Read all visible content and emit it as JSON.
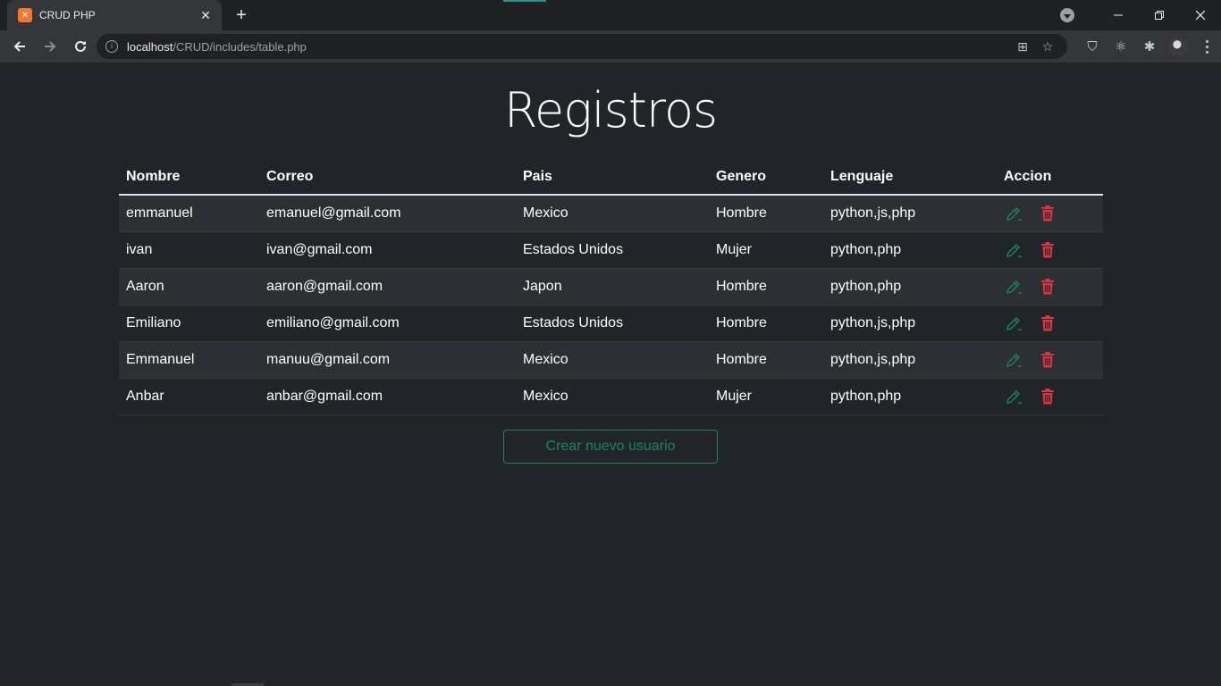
{
  "browser": {
    "tab_title": "CRUD PHP",
    "favicon_text": "⌘",
    "url_host": "localhost",
    "url_path": "/CRUD/includes/table.php"
  },
  "page": {
    "title": "Registros",
    "headers": [
      "Nombre",
      "Correo",
      "Pais",
      "Genero",
      "Lenguaje",
      "Accion"
    ],
    "rows": [
      {
        "nombre": "emmanuel",
        "correo": "emanuel@gmail.com",
        "pais": "Mexico",
        "genero": "Hombre",
        "lenguaje": "python,js,php"
      },
      {
        "nombre": "ivan",
        "correo": "ivan@gmail.com",
        "pais": "Estados Unidos",
        "genero": "Mujer",
        "lenguaje": "python,php"
      },
      {
        "nombre": "Aaron",
        "correo": "aaron@gmail.com",
        "pais": "Japon",
        "genero": "Hombre",
        "lenguaje": "python,php"
      },
      {
        "nombre": "Emiliano",
        "correo": "emiliano@gmail.com",
        "pais": "Estados Unidos",
        "genero": "Hombre",
        "lenguaje": "python,js,php"
      },
      {
        "nombre": "Emmanuel",
        "correo": "manuu@gmail.com",
        "pais": "Mexico",
        "genero": "Hombre",
        "lenguaje": "python,js,php"
      },
      {
        "nombre": "Anbar",
        "correo": "anbar@gmail.com",
        "pais": "Mexico",
        "genero": "Mujer",
        "lenguaje": "python,php"
      }
    ],
    "create_button": "Crear nuevo usuario"
  },
  "colors": {
    "edit": "#198754",
    "delete": "#dc3545",
    "background": "#212529"
  }
}
